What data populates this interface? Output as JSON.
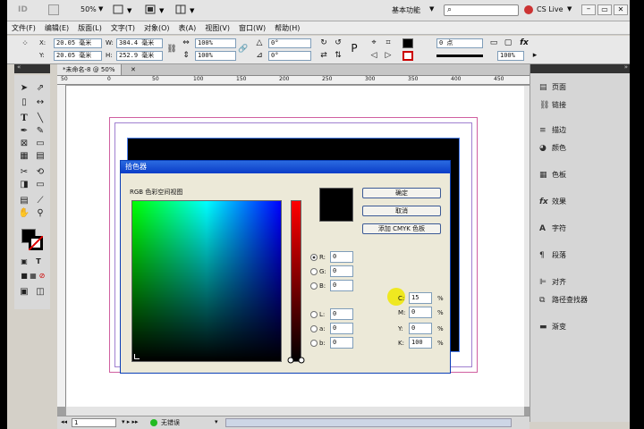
{
  "title_bar": {
    "app_logo": "ID",
    "zoom": "50%",
    "workspace": "基本功能",
    "search_placeholder": "",
    "cs_live": "CS Live"
  },
  "menu": [
    "文件(F)",
    "编辑(E)",
    "版面(L)",
    "文字(T)",
    "对象(O)",
    "表(A)",
    "视图(V)",
    "窗口(W)",
    "帮助(H)"
  ],
  "control": {
    "x_label": "X:",
    "x_value": "20.05 毫米",
    "y_label": "Y:",
    "y_value": "20.05 毫米",
    "w_label": "W:",
    "w_value": "384.4 毫米",
    "h_label": "H:",
    "h_value": "252.9 毫米",
    "scale_x": "100%",
    "scale_y": "100%",
    "rotate": "0°",
    "shear": "0°",
    "stroke_weight": "0 点",
    "opacity": "100%"
  },
  "doc_tab": "*未命名-8 @ 50%",
  "ruler_labels": [
    "50",
    "0",
    "50",
    "100",
    "150",
    "200",
    "250",
    "300",
    "350",
    "400",
    "450"
  ],
  "panels": [
    {
      "icon": "page",
      "label": "页面"
    },
    {
      "icon": "link",
      "label": "链接"
    },
    {
      "icon": "stroke",
      "label": "描边"
    },
    {
      "icon": "color",
      "label": "颜色"
    },
    {
      "icon": "swatch",
      "label": "色板"
    },
    {
      "icon": "fx",
      "label": "效果"
    },
    {
      "icon": "char",
      "label": "字符"
    },
    {
      "icon": "para",
      "label": "段落"
    },
    {
      "icon": "align",
      "label": "对齐"
    },
    {
      "icon": "pathfinder",
      "label": "路径查找器"
    },
    {
      "icon": "gradient",
      "label": "渐变"
    }
  ],
  "status": {
    "page": "1",
    "errors": "无错误"
  },
  "dialog": {
    "title": "拾色器",
    "view_label": "RGB 色彩空间视图",
    "ok": "确定",
    "cancel": "取消",
    "add_cmyk": "添加 CMYK 色板",
    "r_label": "R:",
    "r_value": "0",
    "g_label": "G:",
    "g_value": "0",
    "b_label": "B:",
    "b_value": "0",
    "l_label": "L:",
    "l_value": "0",
    "a_label": "a:",
    "a_value": "0",
    "bb_label": "b:",
    "bb_value": "0",
    "c_label": "C:",
    "c_value": "15",
    "m_label": "M:",
    "m_value": "0",
    "y_label": "Y:",
    "y_value": "0",
    "k_label": "K:",
    "k_value": "100",
    "pct": "%"
  },
  "colors": {
    "accent": "#0a3cc8",
    "swatch": "#000000",
    "cursor": "#f0e800"
  }
}
